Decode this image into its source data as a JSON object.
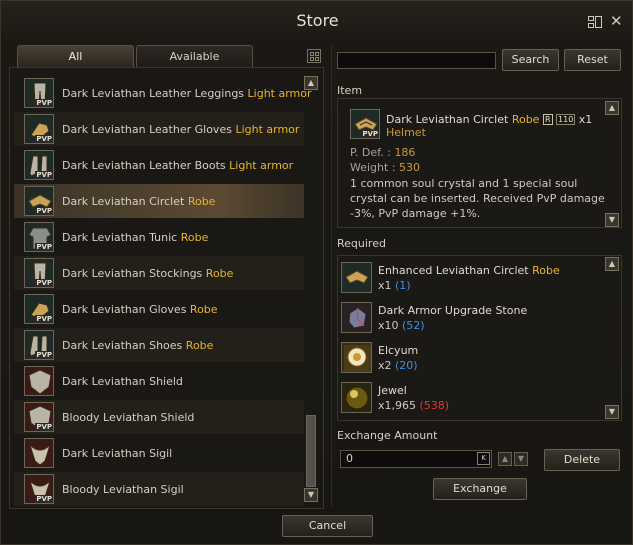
{
  "window": {
    "title": "Store"
  },
  "tabs": [
    {
      "label": "All",
      "active": true
    },
    {
      "label": "Available",
      "active": false
    }
  ],
  "search": {
    "placeholder": "",
    "value": "",
    "search_label": "Search",
    "reset_label": "Reset"
  },
  "list": [
    {
      "name": "Dark Leviathan Leather Leggings",
      "grade": "Light armor",
      "icon": "leggings-icon",
      "pvp": "PVP"
    },
    {
      "name": "Dark Leviathan Leather Gloves",
      "grade": "Light armor",
      "icon": "gloves-icon",
      "pvp": "PVP"
    },
    {
      "name": "Dark Leviathan Leather Boots",
      "grade": "Light armor",
      "icon": "boots-icon",
      "pvp": "PVP"
    },
    {
      "name": "Dark Leviathan Circlet",
      "grade": "Robe",
      "icon": "circlet-icon",
      "pvp": "PVP",
      "selected": true
    },
    {
      "name": "Dark Leviathan Tunic",
      "grade": "Robe",
      "icon": "tunic-icon",
      "pvp": "PVP"
    },
    {
      "name": "Dark Leviathan Stockings",
      "grade": "Robe",
      "icon": "stockings-icon",
      "pvp": "PVP"
    },
    {
      "name": "Dark Leviathan Gloves",
      "grade": "Robe",
      "icon": "gloves-icon",
      "pvp": "PVP"
    },
    {
      "name": "Dark Leviathan Shoes",
      "grade": "Robe",
      "icon": "shoes-icon",
      "pvp": "PVP"
    },
    {
      "name": "Dark Leviathan Shield",
      "grade": "",
      "icon": "shield-icon",
      "pvp": ""
    },
    {
      "name": "Bloody Leviathan Shield",
      "grade": "",
      "icon": "shield-icon",
      "pvp": "PVP"
    },
    {
      "name": "Dark Leviathan Sigil",
      "grade": "",
      "icon": "sigil-icon",
      "pvp": ""
    },
    {
      "name": "Bloody Leviathan Sigil",
      "grade": "",
      "icon": "sigil-icon",
      "pvp": "PVP"
    }
  ],
  "item": {
    "section_label": "Item",
    "name": "Dark Leviathan Circlet",
    "grade": "Robe",
    "rank_badge": "R",
    "level_badge": "110",
    "qty": "x1",
    "type": "Helmet",
    "pvp": "PVP",
    "pdef_label": "P. Def. :",
    "pdef_value": "186",
    "weight_label": "Weight :",
    "weight_value": "530",
    "description": "1 common soul crystal and 1 special soul crystal can be inserted. Received PvP damage -3%, PvP damage +1%."
  },
  "required": {
    "section_label": "Required",
    "items": [
      {
        "name": "Enhanced Leviathan Circlet",
        "grade": "Robe",
        "qty": "x1",
        "have": "(1)",
        "have_status": "ok",
        "icon": "circlet-icon"
      },
      {
        "name": "Dark Armor Upgrade Stone",
        "grade": "",
        "qty": "x10",
        "have": "(52)",
        "have_status": "ok",
        "icon": "stone-icon"
      },
      {
        "name": "Elcyum",
        "grade": "",
        "qty": "x2",
        "have": "(20)",
        "have_status": "ok",
        "icon": "elcyum-icon"
      },
      {
        "name": "Jewel",
        "grade": "",
        "qty": "x1,965",
        "have": "(538)",
        "have_status": "insufficient",
        "icon": "jewel-icon"
      }
    ]
  },
  "exchange": {
    "amount_label": "Exchange Amount",
    "amount_value": "0",
    "k_label": "K",
    "delete_label": "Delete",
    "exchange_label": "Exchange"
  },
  "footer": {
    "cancel_label": "Cancel"
  },
  "colors": {
    "grade": "#e8b428",
    "have_ok": "#3f8fe0",
    "have_insufficient": "#e03a2f",
    "selected_row": "#5b4a33"
  }
}
